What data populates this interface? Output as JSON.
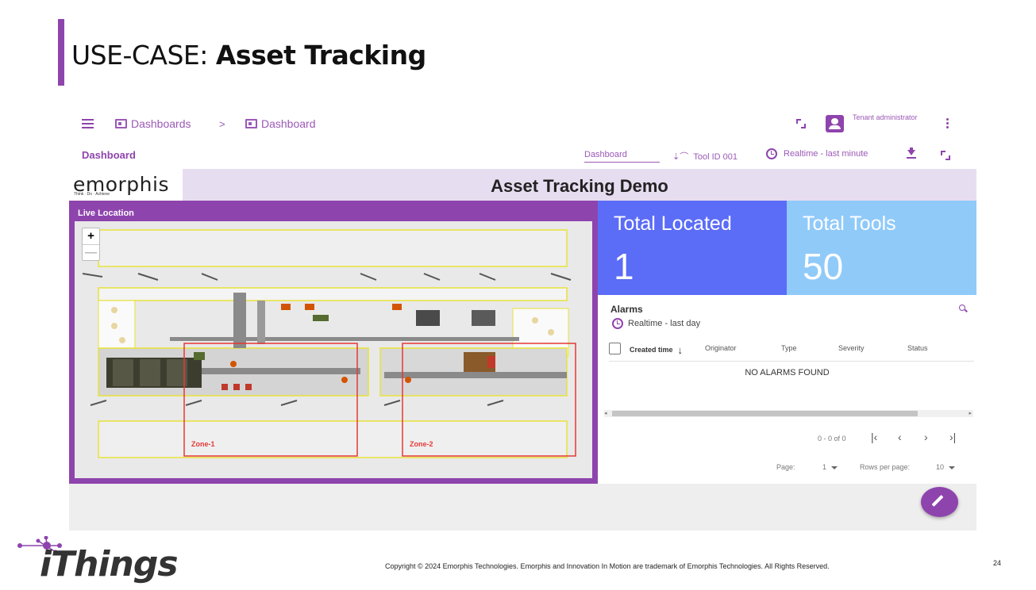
{
  "slide": {
    "title_prefix": "USE-CASE: ",
    "title_main": "Asset Tracking",
    "page_number": "24",
    "copyright": "Copyright © 2024 Emorphis Technologies. Emorphis and Innovation In Motion are trademark of Emorphis Technologies. All Rights Reserved.",
    "brand": "iThings",
    "accent_color": "#8e44ad"
  },
  "app": {
    "breadcrumb": [
      {
        "label": "Dashboards",
        "icon": "dashboard-icon"
      },
      {
        "label": "Dashboard",
        "icon": "dashboard-icon"
      }
    ],
    "breadcrumb_sep": ">",
    "user_role": "Tenant administrator",
    "page_title": "Dashboard",
    "dashboard_select": "Dashboard",
    "tool_filter": "Tool ID 001",
    "time_window": "Realtime - last minute"
  },
  "dashboard": {
    "logo_text": "emorphis",
    "logo_tagline": "Think · Do · Achieve",
    "title": "Asset Tracking Demo",
    "map": {
      "label": "Live Location",
      "zoom_in": "+",
      "zoom_out": "—",
      "zones": [
        "Zone-1",
        "Zone-2"
      ]
    },
    "kpis": [
      {
        "title": "Total Located",
        "value": "1",
        "color": "#5b6cf7"
      },
      {
        "title": "Total Tools",
        "value": "50",
        "color": "#90caf9"
      }
    ],
    "alarms": {
      "title": "Alarms",
      "time_window": "Realtime - last day",
      "columns": [
        "Created time",
        "Originator",
        "Type",
        "Severity",
        "Status"
      ],
      "empty_text": "NO ALARMS FOUND",
      "range": "0 - 0 of 0",
      "page_label": "Page:",
      "page_value": "1",
      "rows_label": "Rows per page:",
      "rows_value": "10"
    }
  }
}
